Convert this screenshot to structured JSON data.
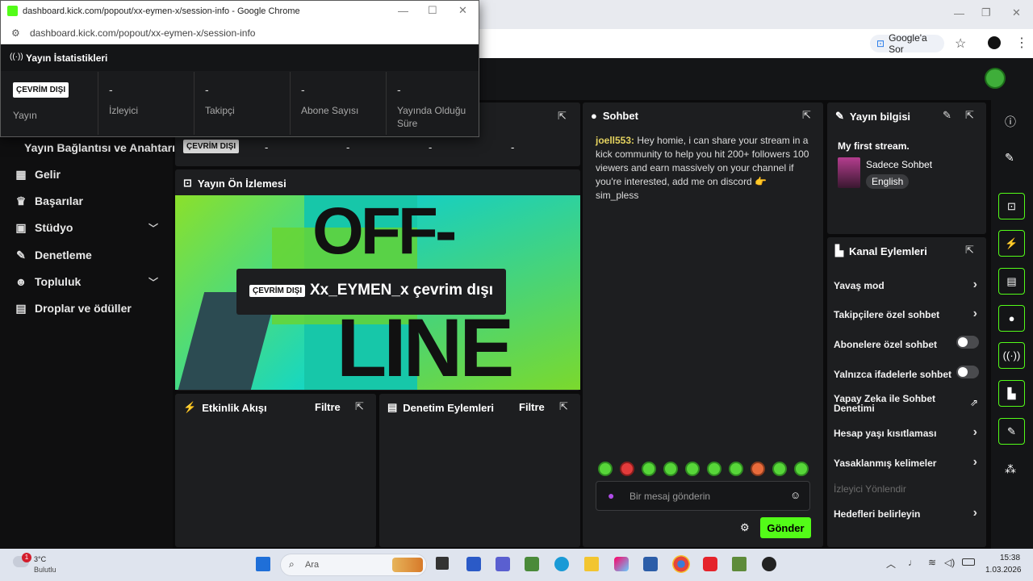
{
  "browser": {
    "tab_title": "Google'a Sor",
    "bookmark_star": "☆"
  },
  "popup": {
    "title": "dashboard.kick.com/popout/xx-eymen-x/session-info - Google Chrome",
    "url": "dashboard.kick.com/popout/xx-eymen-x/session-info",
    "header": "Yayın İstatistikleri",
    "stats": [
      {
        "badge": "ÇEVRİM DIŞI",
        "label": "Yayın"
      },
      {
        "value": "-",
        "label": "İzleyici"
      },
      {
        "value": "-",
        "label": "Takipçi"
      },
      {
        "value": "-",
        "label": "Abone Sayısı"
      },
      {
        "value": "-",
        "label": "Yayında Olduğu Süre"
      }
    ]
  },
  "sidebar": {
    "items": [
      {
        "label": "Yayın Bağlantısı ve Anahtarı",
        "icon": "key-icon"
      },
      {
        "label": "Gelir",
        "icon": "bank-icon"
      },
      {
        "label": "Başarılar",
        "icon": "trophy-icon"
      },
      {
        "label": "Stüdyo",
        "icon": "studio-icon"
      },
      {
        "label": "Denetleme",
        "icon": "wrench-icon"
      },
      {
        "label": "Topluluk",
        "icon": "people-icon"
      },
      {
        "label": "Droplar ve ödüller",
        "icon": "gift-icon"
      }
    ]
  },
  "stats_behind": {
    "badge": "ÇEVRİM DIŞI",
    "values": [
      "-",
      "-",
      "-",
      "-"
    ]
  },
  "preview": {
    "title": "Yayın Ön İzlemesi",
    "badge": "ÇEVRİM DIŞI",
    "channel_offline": "Xx_EYMEN_x çevrim dışı"
  },
  "activity": {
    "title": "Etkinlik Akışı",
    "filter": "Filtre"
  },
  "mod_actions": {
    "title": "Denetim Eylemleri",
    "filter": "Filtre"
  },
  "chat": {
    "title": "Sohbet",
    "message": {
      "user": "joell553:",
      "text": "Hey homie, i can share your stream in a kick community to help you hit 200+ followers 100 viewers and earn massively on your channel if you're interested, add me on discord 👉 sim_pless"
    },
    "placeholder": "Bir mesaj gönderin",
    "send": "Gönder"
  },
  "stream_info": {
    "title": "Yayın bilgisi",
    "stream_title": "My first stream.",
    "category": "Sadece Sohbet",
    "language": "English"
  },
  "channel_actions": {
    "title": "Kanal Eylemleri",
    "items": [
      {
        "label": "Yavaş mod",
        "kind": "arrow"
      },
      {
        "label": "Takipçilere özel sohbet",
        "kind": "arrow"
      },
      {
        "label": "Abonelere özel sohbet",
        "kind": "toggle",
        "on": false
      },
      {
        "label": "Yalnızca ifadelerle sohbet",
        "kind": "toggle",
        "on": false
      },
      {
        "label": "Yapay Zeka ile Sohbet Denetimi",
        "kind": "external"
      },
      {
        "label": "Hesap yaşı kısıtlaması",
        "kind": "arrow"
      },
      {
        "label": "Yasaklanmış kelimeler",
        "kind": "arrow"
      },
      {
        "label": "İzleyici Yönlendir",
        "kind": "disabled"
      },
      {
        "label": "Hedefleri belirleyin",
        "kind": "arrow"
      }
    ]
  },
  "taskbar": {
    "weather_temp": "3°C",
    "weather_desc": "Bulutlu",
    "weather_badge": "1",
    "search": "Ara",
    "time": "15:38",
    "date": "1.03.2026"
  },
  "colors": {
    "accent": "#53fc18",
    "panel": "#1d1e20",
    "bg": "#0b0b0c"
  }
}
